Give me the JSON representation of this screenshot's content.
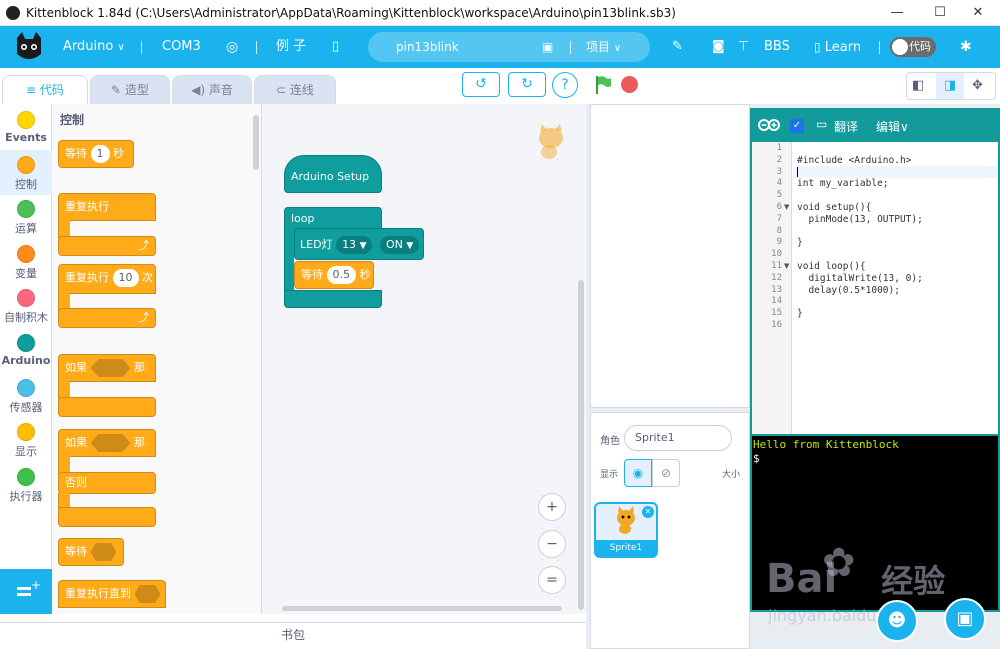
{
  "window": {
    "title": "Kittenblock 1.84d  (C:\\Users\\Administrator\\AppData\\Roaming\\Kittenblock\\workspace\\Arduino\\pin13blink.sb3)",
    "minimize": "—",
    "maximize": "☐",
    "close": "✕"
  },
  "menubar": {
    "board": "Arduino",
    "port": "COM3",
    "examples": "例 子",
    "project_name": "pin13blink",
    "project_menu": "项目",
    "bbs": "BBS",
    "learn": "Learn",
    "code_toggle": "代码"
  },
  "tabs": [
    {
      "label": "代码"
    },
    {
      "label": "造型"
    },
    {
      "label": "声音"
    },
    {
      "label": "连线"
    }
  ],
  "categories": [
    {
      "label": "Events",
      "color": "#ffd500"
    },
    {
      "label": "控制",
      "color": "#ffab19"
    },
    {
      "label": "运算",
      "color": "#4cbf56"
    },
    {
      "label": "变量",
      "color": "#ff8c1a"
    },
    {
      "label": "自制积木",
      "color": "#ff6680"
    },
    {
      "label": "Arduino",
      "color": "#0f9d9d"
    },
    {
      "label": "传感器",
      "color": "#4cbfe6"
    },
    {
      "label": "显示",
      "color": "#ffbf00"
    },
    {
      "label": "执行器",
      "color": "#40bf4a"
    }
  ],
  "palette": {
    "title": "控制",
    "wait": "等待",
    "wait_value": "1",
    "seconds": "秒",
    "forever": "重复执行",
    "repeat": "重复执行",
    "repeat_value": "10",
    "times": "次",
    "if": "如果",
    "then": "那么",
    "if2": "如果",
    "then2": "那么",
    "else": "否则",
    "wait_until": "等待",
    "repeat_until": "重复执行直到"
  },
  "script": {
    "setup": "Arduino Setup",
    "loop": "loop",
    "led_label": "LED灯",
    "led_pin": "13",
    "led_state": "ON",
    "wait": "等待",
    "wait_value": "0.5",
    "seconds": "秒"
  },
  "zoom": {
    "in": "+",
    "out": "−",
    "reset": "="
  },
  "backpack": "书包",
  "sprite": {
    "role_label": "角色",
    "name": "Sprite1",
    "show_label": "显示",
    "size_label": "大小",
    "card_name": "Sprite1"
  },
  "arduino": {
    "translate": "翻译",
    "edit": "编辑∨",
    "line_numbers": [
      "1",
      "2",
      "3",
      "4",
      "5",
      "6",
      "7",
      "8",
      "9",
      "10",
      "11",
      "12",
      "13",
      "14",
      "15",
      "16"
    ],
    "code_lines": [
      "",
      "#include <Arduino.h>",
      "",
      "int my_variable;",
      "",
      "void setup(){",
      "  pinMode(13, OUTPUT);",
      "",
      "}",
      "",
      "void loop(){",
      "  digitalWrite(13, 0);",
      "  delay(0.5*1000);",
      "",
      "}",
      ""
    ],
    "console_line1": "Hello from Kittenblock",
    "console_line2": "$"
  },
  "watermark": {
    "brand": "Bai",
    "brand_cn": "经验",
    "url": "jingyan.baidu.com"
  },
  "colors": {
    "accent": "#1ab3ee",
    "control": "#ffab19",
    "arduino": "#0f9d9d",
    "console_text": "#c8e600"
  }
}
